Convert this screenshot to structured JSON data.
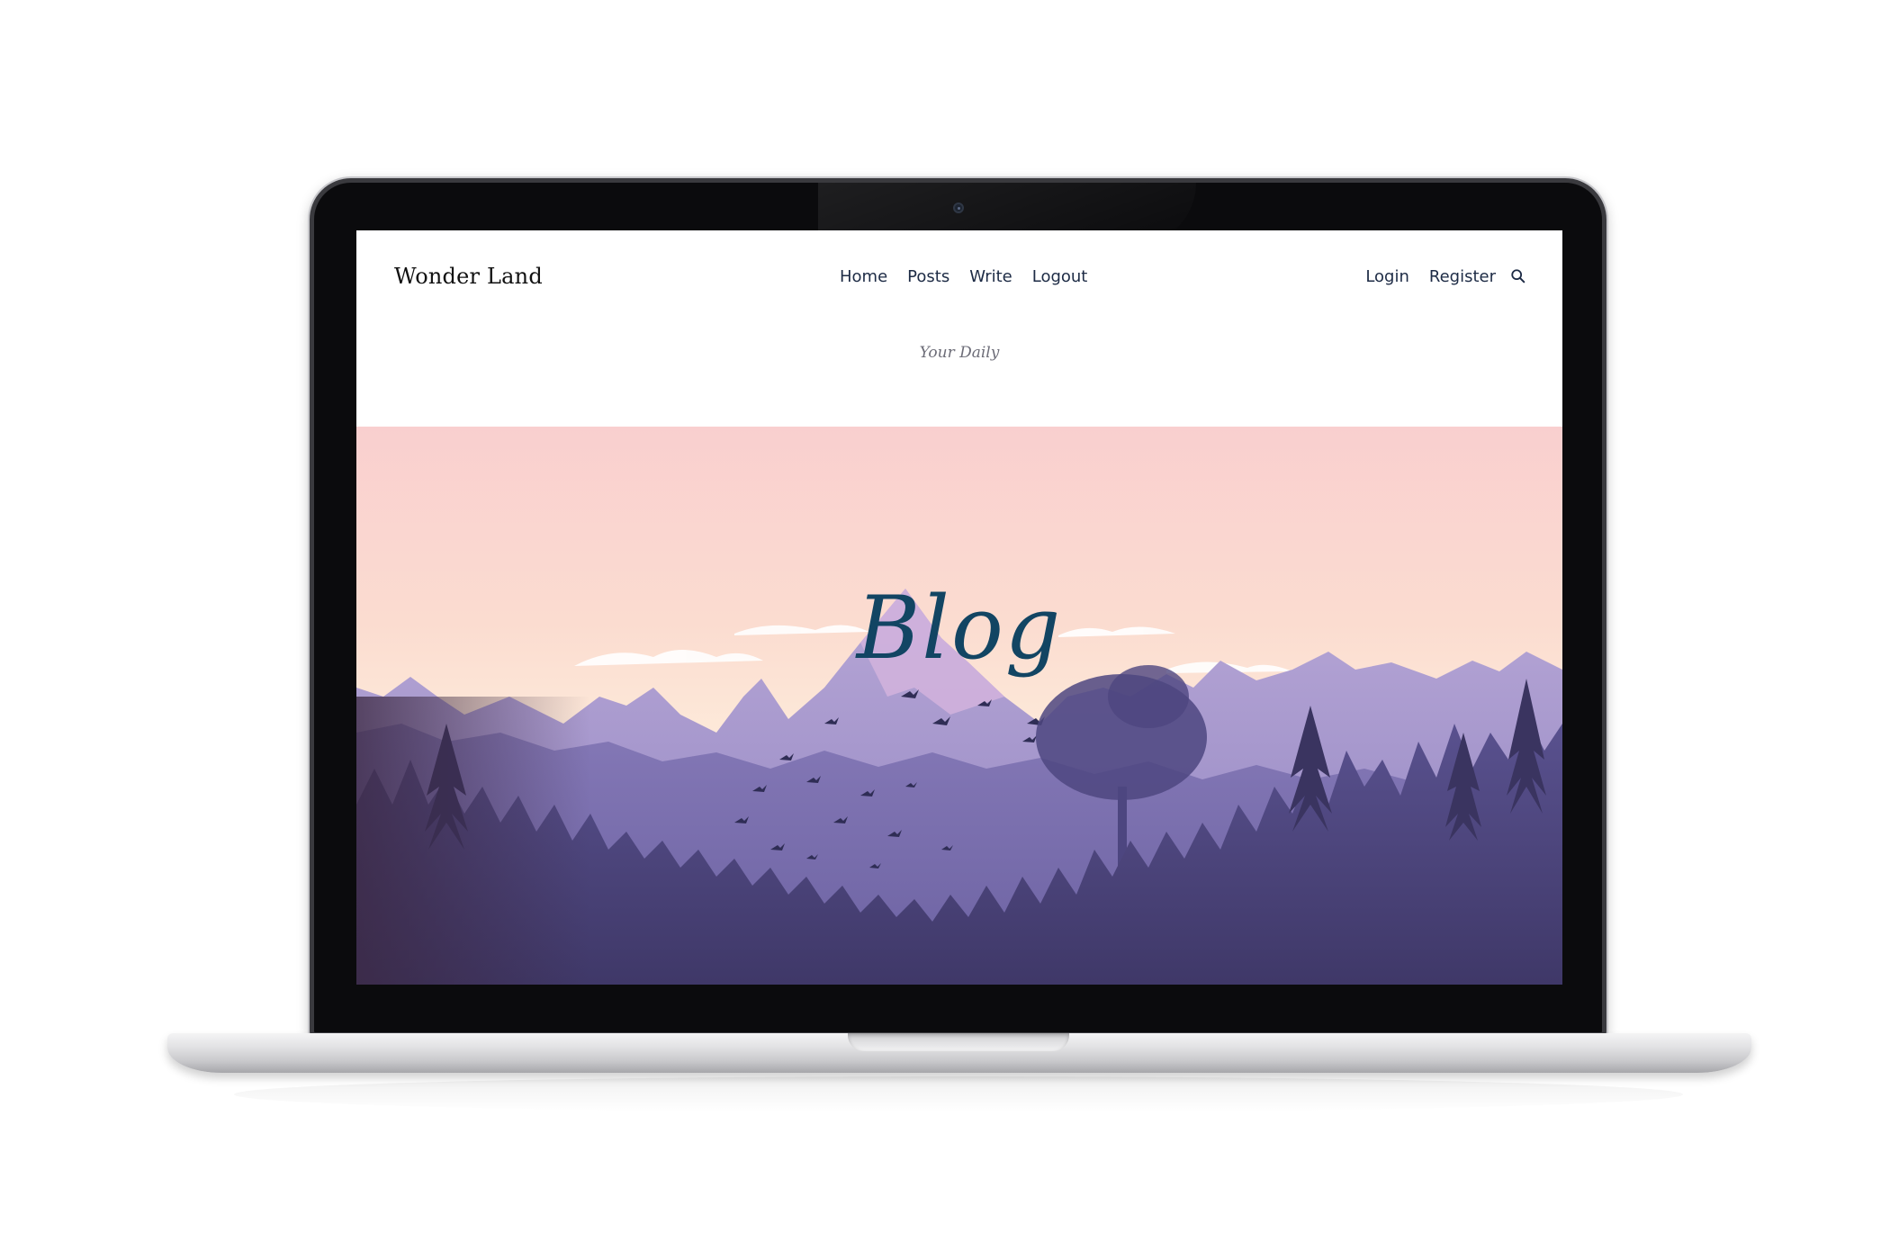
{
  "site": {
    "logo": "Wonder Land"
  },
  "nav": {
    "center": [
      "Home",
      "Posts",
      "Write",
      "Logout"
    ],
    "right": [
      "Login",
      "Register"
    ],
    "search_icon": "search-icon"
  },
  "header": {
    "tagline": "Your Daily",
    "title": "Blog"
  },
  "colors": {
    "title": "#124563",
    "nav_text": "#1d2b45",
    "hero_top": "#f9cfcf",
    "mountain": "#8f84c0",
    "forest_dark": "#3d3766"
  }
}
